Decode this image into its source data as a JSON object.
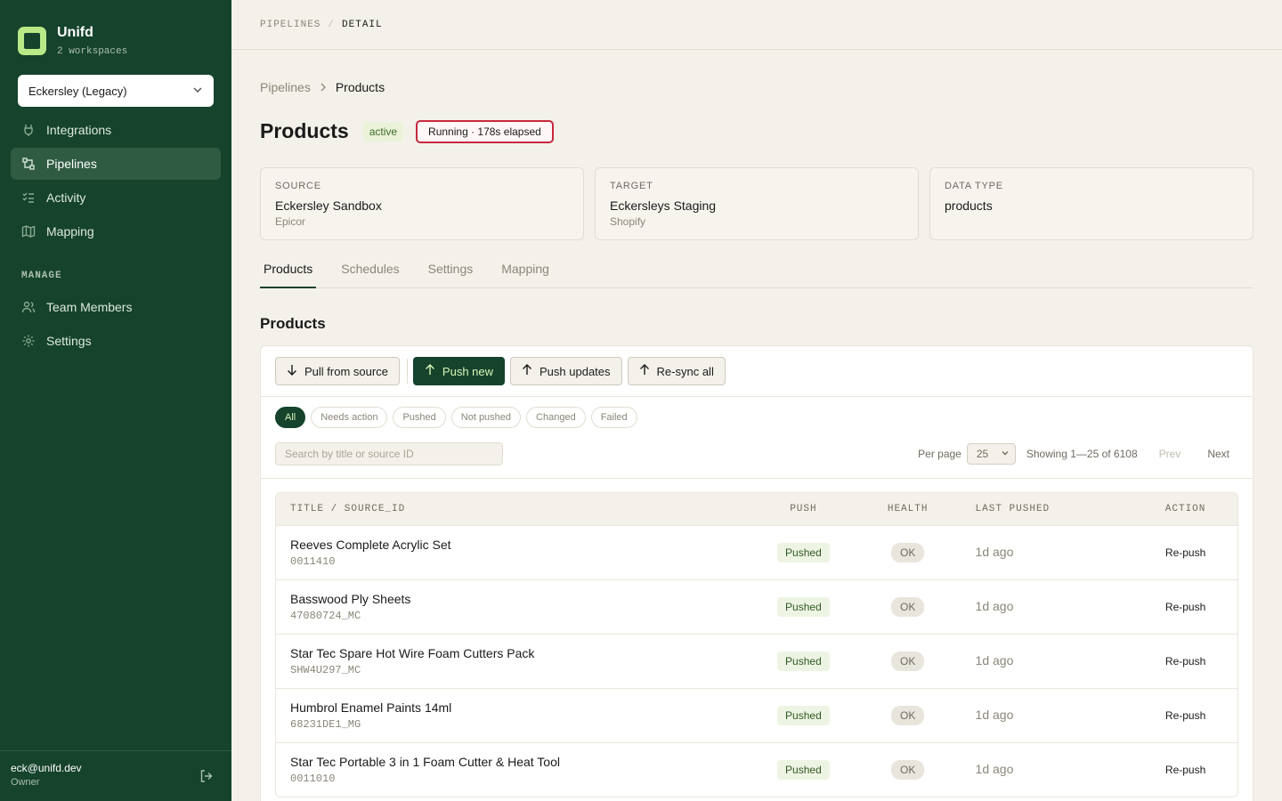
{
  "sidebar": {
    "brand": {
      "name": "Unifd",
      "subtitle": "2 workspaces"
    },
    "workspace": "Eckersley (Legacy)",
    "nav": [
      {
        "label": "Integrations",
        "icon": "plug-icon"
      },
      {
        "label": "Pipelines",
        "icon": "pipeline-icon",
        "active": true
      },
      {
        "label": "Activity",
        "icon": "activity-list-icon"
      },
      {
        "label": "Mapping",
        "icon": "map-icon"
      }
    ],
    "manage_label": "MANAGE",
    "manage": [
      {
        "label": "Team Members",
        "icon": "users-icon"
      },
      {
        "label": "Settings",
        "icon": "gear-icon"
      }
    ],
    "user": {
      "email": "eck@unifd.dev",
      "role": "Owner"
    }
  },
  "topbar": {
    "root": "PIPELINES",
    "sep": "/",
    "current": "DETAIL"
  },
  "breadcrumb": {
    "parent": "Pipelines",
    "current": "Products"
  },
  "page": {
    "title": "Products",
    "status": "active",
    "running": "Running · 178s elapsed"
  },
  "cards": [
    {
      "label": "SOURCE",
      "value": "Eckersley Sandbox",
      "sub": "Epicor"
    },
    {
      "label": "TARGET",
      "value": "Eckersleys Staging",
      "sub": "Shopify"
    },
    {
      "label": "DATA TYPE",
      "value": "products",
      "sub": ""
    }
  ],
  "tabs": [
    "Products",
    "Schedules",
    "Settings",
    "Mapping"
  ],
  "section_title": "Products",
  "toolbar": {
    "pull": "Pull from source",
    "push_new": "Push new",
    "push_updates": "Push updates",
    "resync": "Re-sync all"
  },
  "filters": [
    "All",
    "Needs action",
    "Pushed",
    "Not pushed",
    "Changed",
    "Failed"
  ],
  "search": {
    "placeholder": "Search by title or source ID"
  },
  "pager": {
    "per_page_label": "Per page",
    "per_page": "25",
    "showing": "Showing 1—25 of 6108",
    "prev": "Prev",
    "next": "Next"
  },
  "table": {
    "headers": {
      "title": "TITLE / SOURCE_ID",
      "push": "PUSH",
      "health": "HEALTH",
      "last": "LAST PUSHED",
      "action": "ACTION"
    },
    "rows": [
      {
        "title": "Reeves Complete Acrylic Set",
        "id": "0011410",
        "push": "Pushed",
        "health": "OK",
        "last": "1d ago",
        "action": "Re-push"
      },
      {
        "title": "Basswood Ply Sheets",
        "id": "47080724_MC",
        "push": "Pushed",
        "health": "OK",
        "last": "1d ago",
        "action": "Re-push"
      },
      {
        "title": "Star Tec Spare Hot Wire Foam Cutters Pack",
        "id": "SHW4U297_MC",
        "push": "Pushed",
        "health": "OK",
        "last": "1d ago",
        "action": "Re-push"
      },
      {
        "title": "Humbrol Enamel Paints 14ml",
        "id": "68231DE1_MG",
        "push": "Pushed",
        "health": "OK",
        "last": "1d ago",
        "action": "Re-push"
      },
      {
        "title": "Star Tec Portable 3 in 1 Foam Cutter & Heat Tool",
        "id": "0011010",
        "push": "Pushed",
        "health": "OK",
        "last": "1d ago",
        "action": "Re-push"
      }
    ]
  }
}
